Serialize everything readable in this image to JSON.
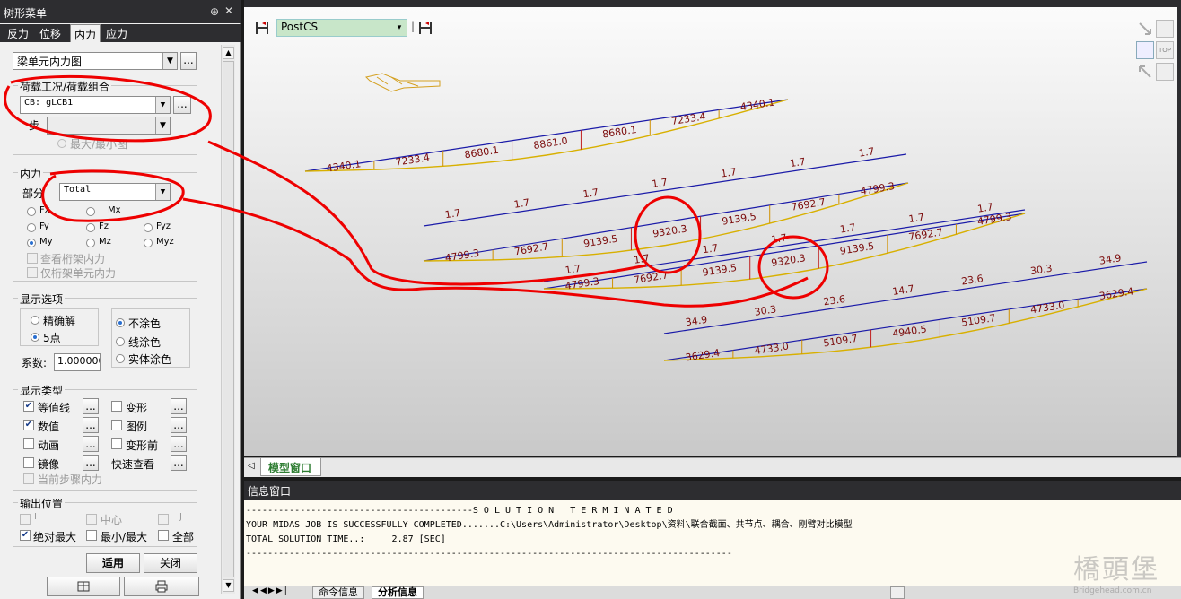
{
  "panel": {
    "title": "树形菜单",
    "pin_glyph": "⊕",
    "close_glyph": "✕",
    "tabs": [
      "反力",
      "位移",
      "内力",
      "应力"
    ],
    "active_tab": "内力",
    "result_type": "梁单元内力图",
    "load_group_label": "荷载工况/荷载组合",
    "load_case_value": "CB: gLCB1",
    "step_label": "步",
    "step_value": "",
    "minmax_label": "最大/最小图",
    "force_group_label": "内力",
    "part_label": "部分",
    "part_value": "Total",
    "components": [
      "Fx",
      "Mx",
      "Fy",
      "Fz",
      "Fyz",
      "My",
      "Mz",
      "Myz"
    ],
    "selected_component": "My",
    "truss_check_1": "查看桁架内力",
    "truss_check_2": "仅桁架单元内力",
    "display_options_label": "显示选项",
    "precise_label": "精确解",
    "five_point_label": "5点",
    "no_fill_label": "不涂色",
    "line_fill_label": "线涂色",
    "solid_fill_label": "实体涂色",
    "coef_label": "系数:",
    "coef_value": "1.000000",
    "display_type_label": "显示类型",
    "contour_label": "等值线",
    "deform_label": "变形",
    "value_label": "数值",
    "legend_label": "图例",
    "animation_label": "动画",
    "pre_deform_label": "变形前",
    "mirror_label": "镜像",
    "quick_view_label": "快速查看",
    "current_step_label": "当前步骤内力",
    "output_pos_label": "输出位置",
    "pos_i": "I",
    "pos_center": "中心",
    "pos_j": "J",
    "abs_max_label": "绝对最大",
    "minmax2_label": "最小/最大",
    "all_label": "全部",
    "apply_label": "适用",
    "close_label": "关闭",
    "ellipsis": "..."
  },
  "viewport": {
    "cs_value": "PostCS",
    "top_label": "TOP",
    "beams": [
      {
        "values": [
          "4340.1",
          "7233.4",
          "8680.1",
          "8861.0",
          "8680.1",
          "7233.4",
          "4340.1"
        ]
      },
      {
        "values": [
          "1.7",
          "1.7",
          "1.7",
          "1.7",
          "1.7",
          "1.7",
          "1.7"
        ]
      },
      {
        "values": [
          "4799.3",
          "7692.7",
          "9139.5",
          "9320.3",
          "9139.5",
          "7692.7",
          "4799.3"
        ]
      },
      {
        "values": [
          "1.7",
          "1.7",
          "1.7",
          "1.7",
          "1.7",
          "1.7",
          "1.7"
        ]
      },
      {
        "values": [
          "4799.3",
          "7692.7",
          "9139.5",
          "9320.3",
          "9139.5",
          "7692.7",
          "4799.3"
        ]
      },
      {
        "values": [
          "34.9",
          "30.3",
          "23.6",
          "14.7",
          "23.6",
          "30.3",
          "34.9"
        ]
      },
      {
        "values": [
          "3629.4",
          "4733.0",
          "5109.7",
          "4940.5",
          "5109.7",
          "4733.0",
          "3629.4"
        ]
      }
    ]
  },
  "model_tab": "模型窗口",
  "message": {
    "title": "信息窗口",
    "lines": [
      "------------------------------------------S O L U T I O N   T E R M I N A T E D",
      "YOUR MIDAS JOB IS SUCCESSFULLY COMPLETED.......C:\\Users\\Administrator\\Desktop\\资料\\联合截面、共节点、耦合、刚臂对比模型",
      "TOTAL SOLUTION TIME..:     2.87 [SEC]",
      "------------------------------------------------------------------------------------------"
    ],
    "tabs": [
      "命令信息",
      "分析信息"
    ]
  },
  "watermark": {
    "main": "橋頭堡",
    "sub": "Bridgehead.com.cn"
  }
}
